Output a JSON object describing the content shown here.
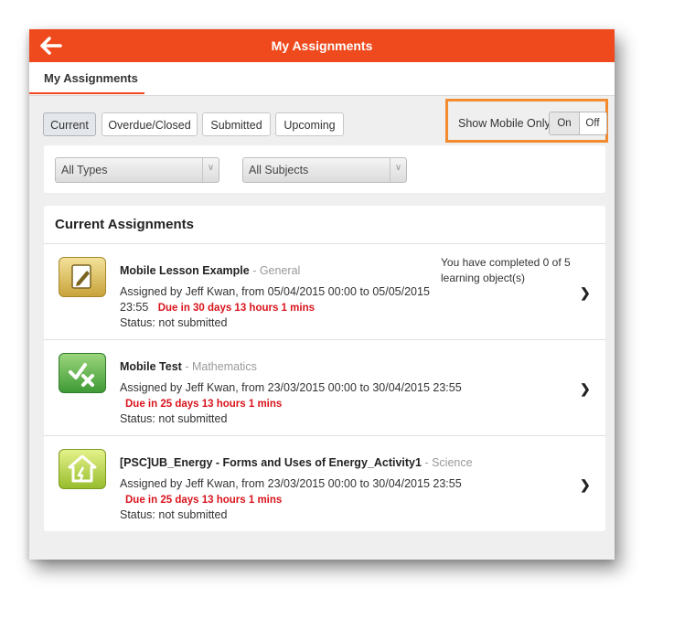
{
  "header": {
    "title": "My Assignments",
    "back_icon": "back-arrow-icon",
    "color": "#ef4a1e"
  },
  "tabs": {
    "active": "My Assignments"
  },
  "filters": {
    "buttons": [
      {
        "label": "Current",
        "active": true
      },
      {
        "label": "Overdue/Closed"
      },
      {
        "label": "Submitted"
      },
      {
        "label": "Upcoming"
      }
    ],
    "show_mobile_only": {
      "label": "Show Mobile Only",
      "on": "On",
      "off": "Off",
      "selected": "On"
    },
    "type_select": "All Types",
    "subject_select": "All Subjects"
  },
  "assignments": {
    "heading": "Current Assignments",
    "items": [
      {
        "title": "Mobile Lesson Example",
        "subject": "- General",
        "assigned_line1": "Assigned by Jeff Kwan, from 05/04/2015 00:00 to 05/05/2015",
        "assigned_line2": "23:55",
        "due": "Due in 30 days 13 hours 1 mins",
        "status": "Status: not submitted",
        "progress": "You have completed 0 of 5 learning object(s)",
        "icon": "lesson-pencil-icon"
      },
      {
        "title": "Mobile Test",
        "subject": "- Mathematics",
        "assigned_line1": "Assigned by Jeff Kwan, from 23/03/2015 00:00 to 30/04/2015 23:55",
        "due": "Due in 25 days 13 hours 1 mins",
        "status": "Status: not submitted",
        "icon": "test-check-cross-icon"
      },
      {
        "title": "[PSC]UB_Energy - Forms and Uses of Energy_Activity1",
        "subject": "- Science",
        "assigned_line1": "Assigned by Jeff Kwan, from 23/03/2015 00:00 to 30/04/2015 23:55",
        "due": "Due in 25 days 13 hours 1 mins",
        "status": "Status: not submitted",
        "icon": "activity-house-icon"
      }
    ]
  }
}
